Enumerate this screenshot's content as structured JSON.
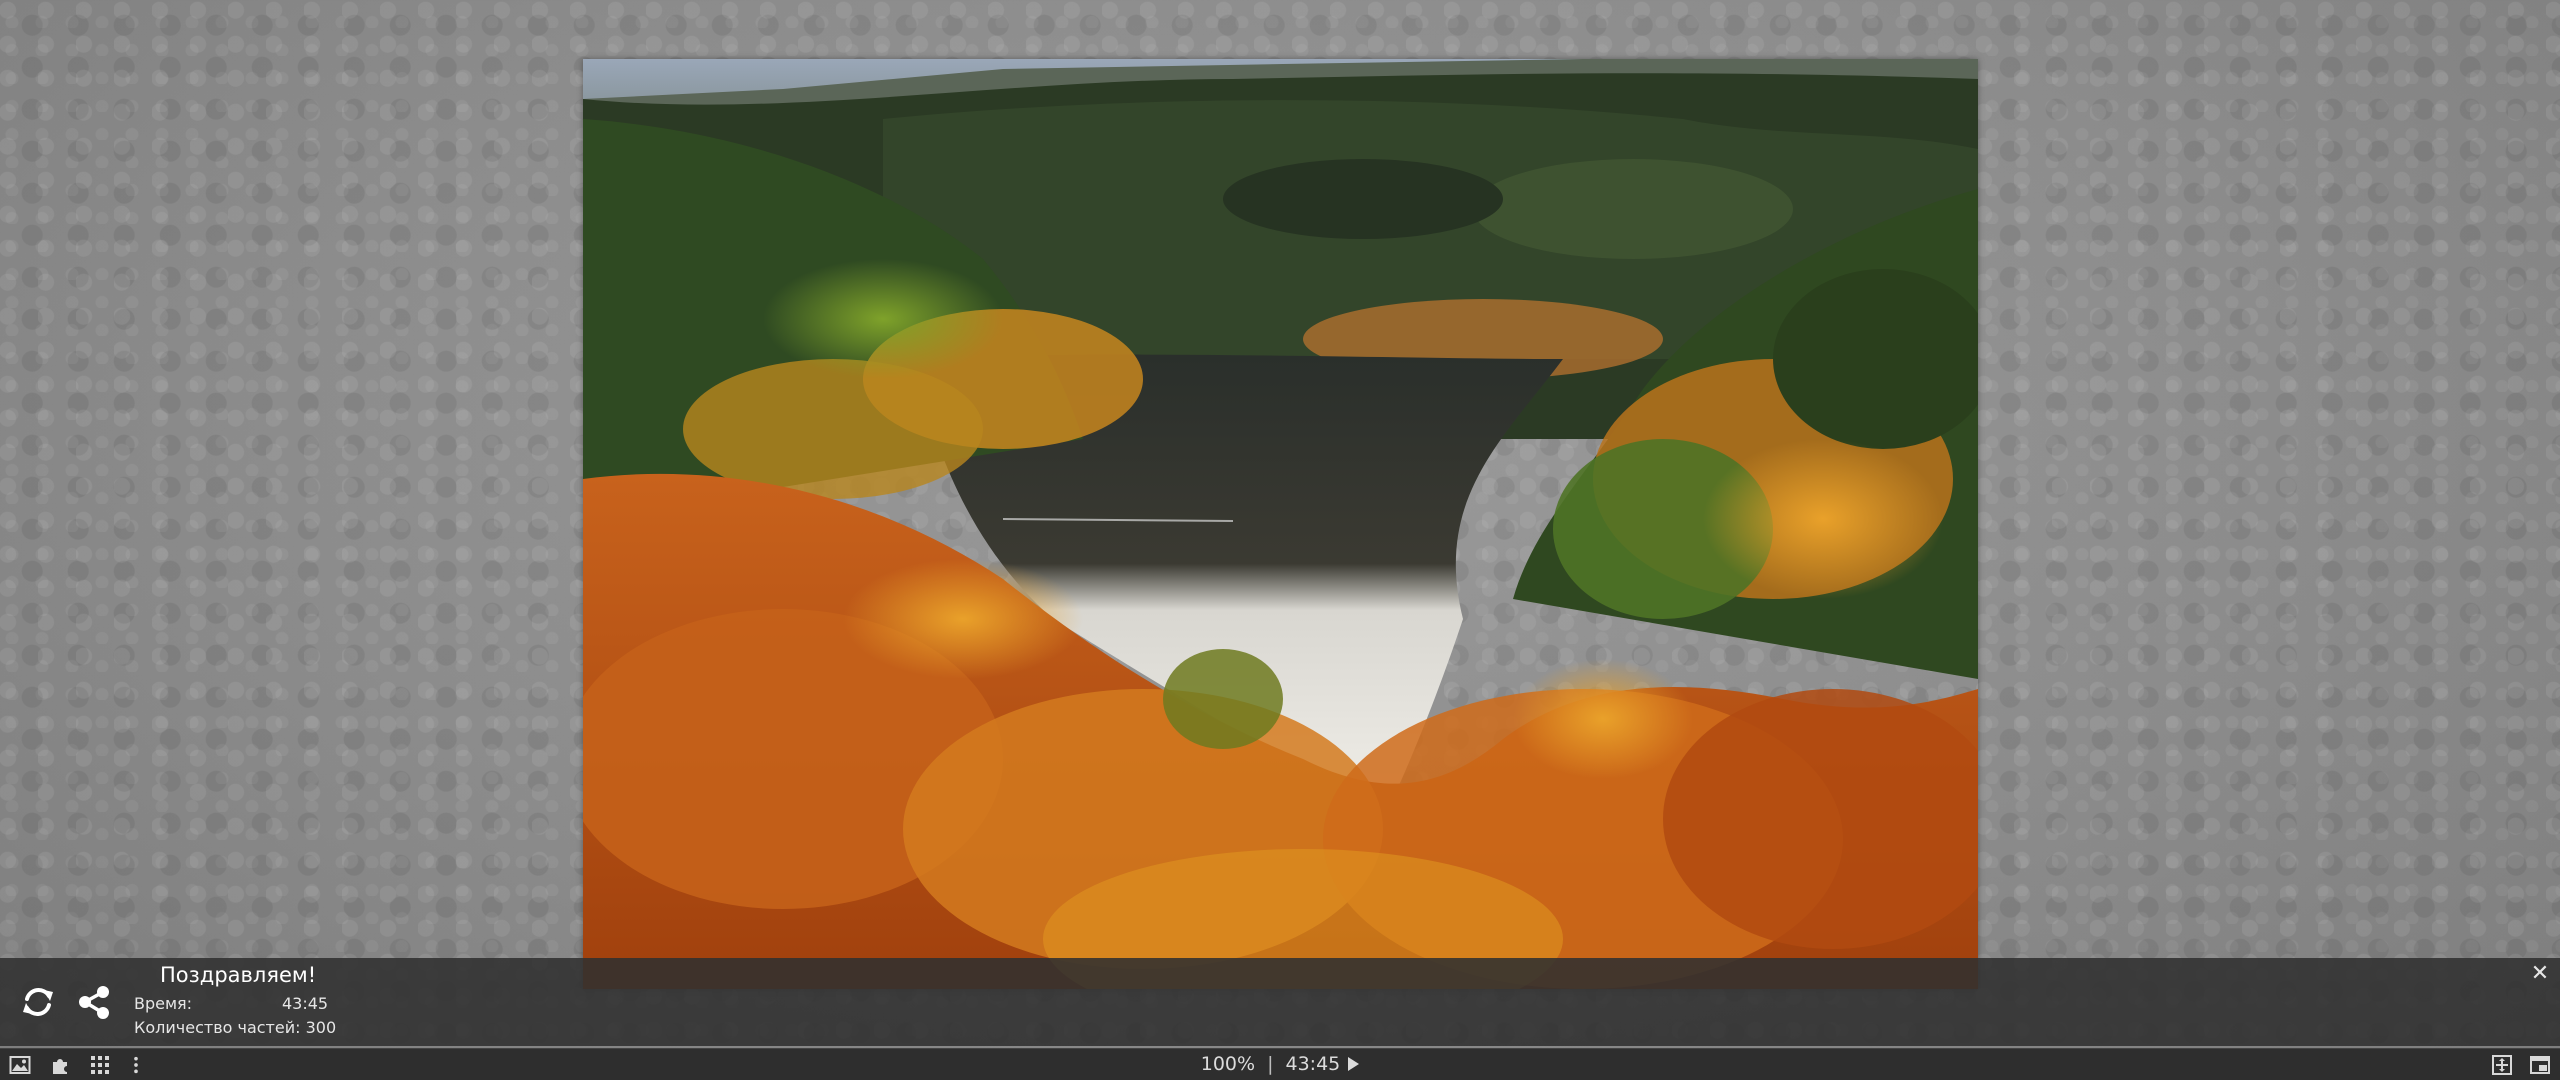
{
  "completion": {
    "title": "Поздравляем!",
    "time_label": "Время:",
    "time_value": "43:45",
    "parts_label": "Количество частей:",
    "parts_value": "300",
    "close_glyph": "✕"
  },
  "toolbar": {
    "zoom": "100%",
    "separator": "|",
    "timer": "43:45",
    "left_icons": [
      "image-icon",
      "puzzle-pieces-icon",
      "grid-icon",
      "more-vertical-icon"
    ],
    "right_icons": [
      "fit-screen-icon",
      "window-mode-icon"
    ]
  },
  "panel_icons": [
    "restart-icon",
    "share-icon"
  ],
  "colors": {
    "background": "#8f8f8f",
    "panel": "#303030",
    "toolbar": "#2e2e2e",
    "text": "#ffffff"
  }
}
